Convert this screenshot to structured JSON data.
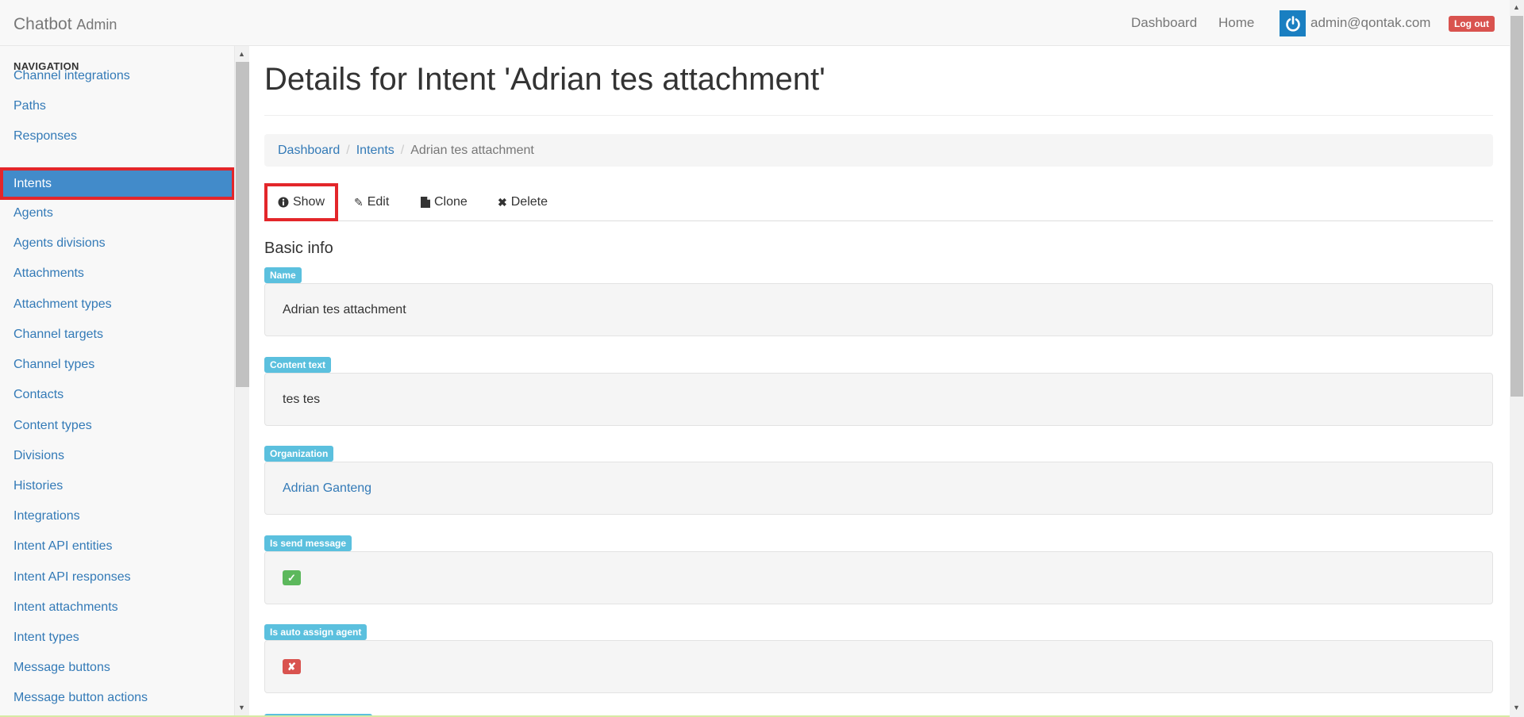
{
  "navbar": {
    "brand": "Chatbot",
    "brand_sub": "Admin",
    "links": [
      "Dashboard",
      "Home"
    ],
    "user_email": "admin@qontak.com",
    "logout_label": "Log out"
  },
  "sidebar": {
    "header": "NAVIGATION",
    "items": [
      {
        "label": "Channel integrations"
      },
      {
        "label": "Paths"
      },
      {
        "label": "Responses"
      },
      {
        "label": "Intents"
      },
      {
        "label": "Agents"
      },
      {
        "label": "Agents divisions"
      },
      {
        "label": "Attachments"
      },
      {
        "label": "Attachment types"
      },
      {
        "label": "Channel targets"
      },
      {
        "label": "Channel types"
      },
      {
        "label": "Contacts"
      },
      {
        "label": "Content types"
      },
      {
        "label": "Divisions"
      },
      {
        "label": "Histories"
      },
      {
        "label": "Integrations"
      },
      {
        "label": "Intent API entities"
      },
      {
        "label": "Intent API responses"
      },
      {
        "label": "Intent attachments"
      },
      {
        "label": "Intent types"
      },
      {
        "label": "Message buttons"
      },
      {
        "label": "Message button actions"
      }
    ],
    "active_item": "Intents"
  },
  "main": {
    "title": "Details for Intent 'Adrian tes attachment'",
    "breadcrumb": {
      "items": [
        "Dashboard",
        "Intents"
      ],
      "current": "Adrian tes attachment"
    },
    "tabs": [
      {
        "label": "Show",
        "icon": "info-circle-icon"
      },
      {
        "label": "Edit",
        "icon": "pencil-icon"
      },
      {
        "label": "Clone",
        "icon": "file-icon"
      },
      {
        "label": "Delete",
        "icon": "times-icon"
      }
    ],
    "active_tab": "Show",
    "section_title": "Basic info",
    "fields": {
      "name": {
        "label": "Name",
        "value": "Adrian tes attachment"
      },
      "content_text": {
        "label": "Content text",
        "value": "tes tes"
      },
      "organization": {
        "label": "Organization",
        "value": "Adrian Ganteng"
      },
      "is_send_message": {
        "label": "Is send message",
        "value": true
      },
      "is_auto_assign_agent": {
        "label": "Is auto assign agent",
        "value": false
      }
    }
  },
  "colors": {
    "accent": "#428bca",
    "link": "#337ab7",
    "label": "#5bc0de",
    "success": "#5cb85c",
    "danger": "#d9534f",
    "highlight": "#e3262a"
  }
}
